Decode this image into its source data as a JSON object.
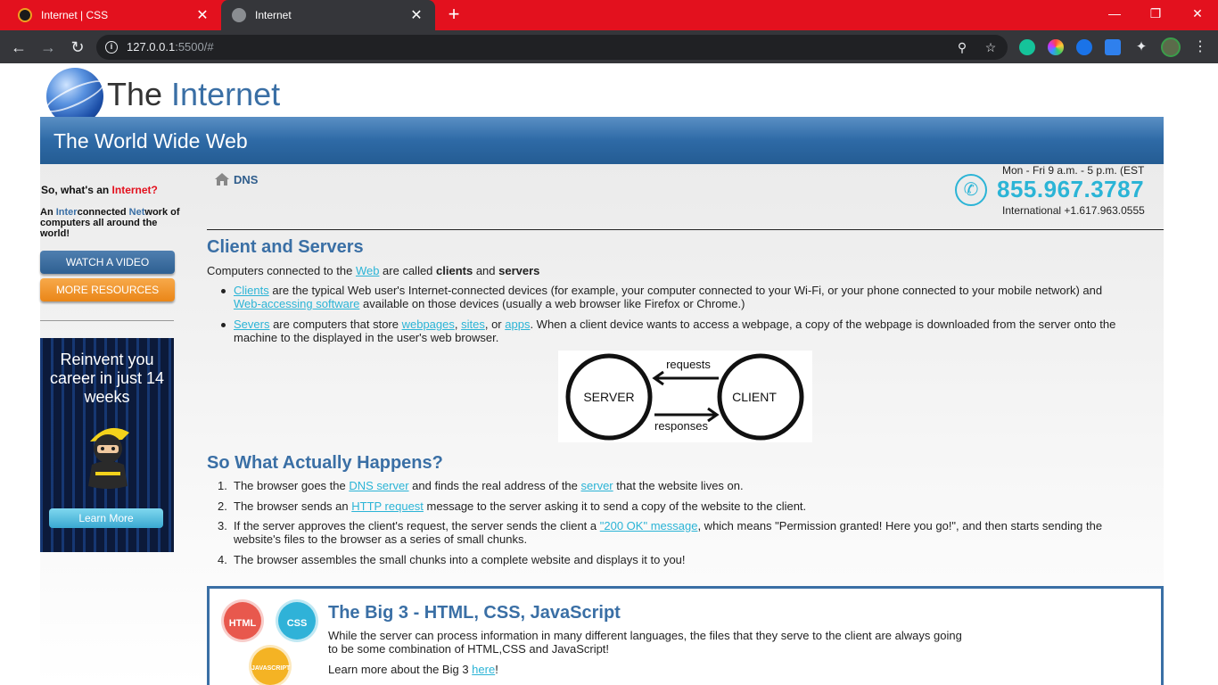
{
  "browser": {
    "tabs": [
      {
        "title": "Internet | CSS",
        "active": false
      },
      {
        "title": "Internet",
        "active": true
      }
    ],
    "new_tab": "+",
    "url_host": "127.0.0.1",
    "url_rest": ":5500/#",
    "accent": "#e3111e"
  },
  "logo": {
    "word1": "The ",
    "word2": "Internet"
  },
  "banner": {
    "title": "The World Wide Web"
  },
  "sidebar": {
    "question_prefix": "So, what's an ",
    "question_highlight": "Internet?",
    "def": {
      "p1": "An ",
      "b1": "Inter",
      "p2": "connected ",
      "b2": "Net",
      "p3": "work of computers all around the world!"
    },
    "watch_video": "WATCH A VIDEO",
    "more_resources": "MORE RESOURCES",
    "ad": {
      "text": "Reinvent you career in just 14 weeks",
      "button": "Learn More"
    }
  },
  "breadcrumb": {
    "label": "DNS"
  },
  "contact": {
    "hours": "Mon - Fri 9 a.m. - 5 p.m. (EST",
    "phone": "855.967.3787",
    "international": "International +1.617.963.0555"
  },
  "section1": {
    "heading": "Client and Servers",
    "intro": {
      "t1": "Computers connected to the ",
      "link": "Web",
      "t2": " are called ",
      "b1": "clients",
      "t3": " and ",
      "b2": "servers"
    },
    "bullet1": {
      "l1": "Clients",
      "t1": " are the typical Web user's Internet-connected devices (for example, your computer connected to your Wi-Fi, or your phone connected to your mobile network) and",
      "l2": "Web-accessing software",
      "t2": " available on those devices (usually a web browser like Firefox or Chrome.)"
    },
    "bullet2": {
      "l1": "Severs",
      "t1": " are computers that store ",
      "l2": "webpages",
      "t2": ", ",
      "l3": "sites",
      "t3": ", or ",
      "l4": "apps",
      "t4": ". When a client device wants to access a webpage, a copy of the webpage is downloaded from the server onto the",
      "t5": "machine to the displayed in the user's web browser."
    },
    "diagram": {
      "server": "SERVER",
      "client": "CLIENT",
      "requests": "requests",
      "responses": "responses"
    }
  },
  "section2": {
    "heading": "So What Actually Happens?",
    "steps": [
      {
        "n": "1.",
        "t1": "The browser goes the ",
        "l1": "DNS server",
        "t2": " and finds the real address of the ",
        "l2": "server",
        "t3": " that the website lives on."
      },
      {
        "n": "2.",
        "t1": "The browser sends an ",
        "l1": "HTTP request",
        "t2": " message to the server asking it to send a copy of the website to the client."
      },
      {
        "n": "3.",
        "t1": "If the server approves the client's request, the server sends the client a ",
        "l1": "\"200 OK\" message",
        "t2": ", which means \"Permission granted! Here you go!\", and then starts sending the",
        "t3": "website's files to the browser as a series of small chunks."
      },
      {
        "n": "4.",
        "t1": "The browser assembles the small chunks into a complete website and displays it to you!"
      }
    ]
  },
  "big3": {
    "title": "The Big 3 - HTML, CSS, JavaScript",
    "text1": "While the server can process information in many different languages, the files that they serve to the client are always going",
    "text2": "to be some combination of HTML,CSS and JavaScript!",
    "learn_prefix": "Learn more about the Big 3 ",
    "learn_link": "here",
    "learn_suffix": "!",
    "badges": {
      "html": "HTML",
      "css": "CSS",
      "js": "JAVASCRIPT"
    }
  }
}
